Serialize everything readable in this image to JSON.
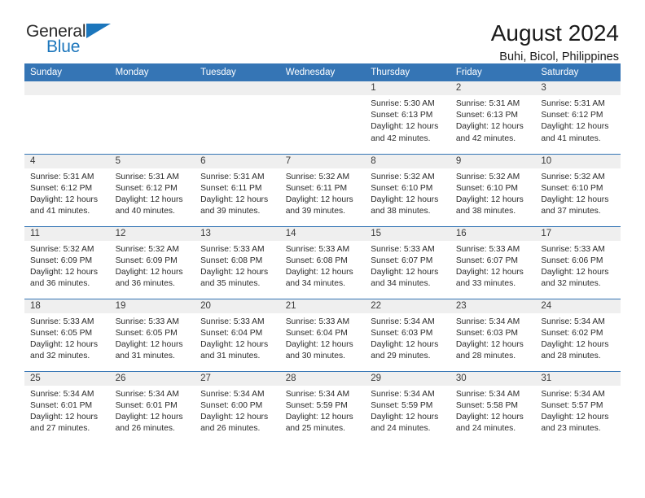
{
  "logo": {
    "word_one": "General",
    "word_two": "Blue",
    "triangle_color": "#1c76bc"
  },
  "header": {
    "title": "August 2024",
    "subtitle": "Buhi, Bicol, Philippines"
  },
  "theme": {
    "header_blue": "#3575b5",
    "daynum_band": "#efefef",
    "text": "#2b2b2b"
  },
  "weekday_headers": [
    "Sunday",
    "Monday",
    "Tuesday",
    "Wednesday",
    "Thursday",
    "Friday",
    "Saturday"
  ],
  "weeks": [
    [
      {
        "day": "",
        "blank": true
      },
      {
        "day": "",
        "blank": true
      },
      {
        "day": "",
        "blank": true
      },
      {
        "day": "",
        "blank": true
      },
      {
        "day": "1",
        "sunrise": "Sunrise: 5:30 AM",
        "sunset": "Sunset: 6:13 PM",
        "daylight_1": "Daylight: 12 hours",
        "daylight_2": "and 42 minutes."
      },
      {
        "day": "2",
        "sunrise": "Sunrise: 5:31 AM",
        "sunset": "Sunset: 6:13 PM",
        "daylight_1": "Daylight: 12 hours",
        "daylight_2": "and 42 minutes."
      },
      {
        "day": "3",
        "sunrise": "Sunrise: 5:31 AM",
        "sunset": "Sunset: 6:12 PM",
        "daylight_1": "Daylight: 12 hours",
        "daylight_2": "and 41 minutes."
      }
    ],
    [
      {
        "day": "4",
        "sunrise": "Sunrise: 5:31 AM",
        "sunset": "Sunset: 6:12 PM",
        "daylight_1": "Daylight: 12 hours",
        "daylight_2": "and 41 minutes."
      },
      {
        "day": "5",
        "sunrise": "Sunrise: 5:31 AM",
        "sunset": "Sunset: 6:12 PM",
        "daylight_1": "Daylight: 12 hours",
        "daylight_2": "and 40 minutes."
      },
      {
        "day": "6",
        "sunrise": "Sunrise: 5:31 AM",
        "sunset": "Sunset: 6:11 PM",
        "daylight_1": "Daylight: 12 hours",
        "daylight_2": "and 39 minutes."
      },
      {
        "day": "7",
        "sunrise": "Sunrise: 5:32 AM",
        "sunset": "Sunset: 6:11 PM",
        "daylight_1": "Daylight: 12 hours",
        "daylight_2": "and 39 minutes."
      },
      {
        "day": "8",
        "sunrise": "Sunrise: 5:32 AM",
        "sunset": "Sunset: 6:10 PM",
        "daylight_1": "Daylight: 12 hours",
        "daylight_2": "and 38 minutes."
      },
      {
        "day": "9",
        "sunrise": "Sunrise: 5:32 AM",
        "sunset": "Sunset: 6:10 PM",
        "daylight_1": "Daylight: 12 hours",
        "daylight_2": "and 38 minutes."
      },
      {
        "day": "10",
        "sunrise": "Sunrise: 5:32 AM",
        "sunset": "Sunset: 6:10 PM",
        "daylight_1": "Daylight: 12 hours",
        "daylight_2": "and 37 minutes."
      }
    ],
    [
      {
        "day": "11",
        "sunrise": "Sunrise: 5:32 AM",
        "sunset": "Sunset: 6:09 PM",
        "daylight_1": "Daylight: 12 hours",
        "daylight_2": "and 36 minutes."
      },
      {
        "day": "12",
        "sunrise": "Sunrise: 5:32 AM",
        "sunset": "Sunset: 6:09 PM",
        "daylight_1": "Daylight: 12 hours",
        "daylight_2": "and 36 minutes."
      },
      {
        "day": "13",
        "sunrise": "Sunrise: 5:33 AM",
        "sunset": "Sunset: 6:08 PM",
        "daylight_1": "Daylight: 12 hours",
        "daylight_2": "and 35 minutes."
      },
      {
        "day": "14",
        "sunrise": "Sunrise: 5:33 AM",
        "sunset": "Sunset: 6:08 PM",
        "daylight_1": "Daylight: 12 hours",
        "daylight_2": "and 34 minutes."
      },
      {
        "day": "15",
        "sunrise": "Sunrise: 5:33 AM",
        "sunset": "Sunset: 6:07 PM",
        "daylight_1": "Daylight: 12 hours",
        "daylight_2": "and 34 minutes."
      },
      {
        "day": "16",
        "sunrise": "Sunrise: 5:33 AM",
        "sunset": "Sunset: 6:07 PM",
        "daylight_1": "Daylight: 12 hours",
        "daylight_2": "and 33 minutes."
      },
      {
        "day": "17",
        "sunrise": "Sunrise: 5:33 AM",
        "sunset": "Sunset: 6:06 PM",
        "daylight_1": "Daylight: 12 hours",
        "daylight_2": "and 32 minutes."
      }
    ],
    [
      {
        "day": "18",
        "sunrise": "Sunrise: 5:33 AM",
        "sunset": "Sunset: 6:05 PM",
        "daylight_1": "Daylight: 12 hours",
        "daylight_2": "and 32 minutes."
      },
      {
        "day": "19",
        "sunrise": "Sunrise: 5:33 AM",
        "sunset": "Sunset: 6:05 PM",
        "daylight_1": "Daylight: 12 hours",
        "daylight_2": "and 31 minutes."
      },
      {
        "day": "20",
        "sunrise": "Sunrise: 5:33 AM",
        "sunset": "Sunset: 6:04 PM",
        "daylight_1": "Daylight: 12 hours",
        "daylight_2": "and 31 minutes."
      },
      {
        "day": "21",
        "sunrise": "Sunrise: 5:33 AM",
        "sunset": "Sunset: 6:04 PM",
        "daylight_1": "Daylight: 12 hours",
        "daylight_2": "and 30 minutes."
      },
      {
        "day": "22",
        "sunrise": "Sunrise: 5:34 AM",
        "sunset": "Sunset: 6:03 PM",
        "daylight_1": "Daylight: 12 hours",
        "daylight_2": "and 29 minutes."
      },
      {
        "day": "23",
        "sunrise": "Sunrise: 5:34 AM",
        "sunset": "Sunset: 6:03 PM",
        "daylight_1": "Daylight: 12 hours",
        "daylight_2": "and 28 minutes."
      },
      {
        "day": "24",
        "sunrise": "Sunrise: 5:34 AM",
        "sunset": "Sunset: 6:02 PM",
        "daylight_1": "Daylight: 12 hours",
        "daylight_2": "and 28 minutes."
      }
    ],
    [
      {
        "day": "25",
        "sunrise": "Sunrise: 5:34 AM",
        "sunset": "Sunset: 6:01 PM",
        "daylight_1": "Daylight: 12 hours",
        "daylight_2": "and 27 minutes."
      },
      {
        "day": "26",
        "sunrise": "Sunrise: 5:34 AM",
        "sunset": "Sunset: 6:01 PM",
        "daylight_1": "Daylight: 12 hours",
        "daylight_2": "and 26 minutes."
      },
      {
        "day": "27",
        "sunrise": "Sunrise: 5:34 AM",
        "sunset": "Sunset: 6:00 PM",
        "daylight_1": "Daylight: 12 hours",
        "daylight_2": "and 26 minutes."
      },
      {
        "day": "28",
        "sunrise": "Sunrise: 5:34 AM",
        "sunset": "Sunset: 5:59 PM",
        "daylight_1": "Daylight: 12 hours",
        "daylight_2": "and 25 minutes."
      },
      {
        "day": "29",
        "sunrise": "Sunrise: 5:34 AM",
        "sunset": "Sunset: 5:59 PM",
        "daylight_1": "Daylight: 12 hours",
        "daylight_2": "and 24 minutes."
      },
      {
        "day": "30",
        "sunrise": "Sunrise: 5:34 AM",
        "sunset": "Sunset: 5:58 PM",
        "daylight_1": "Daylight: 12 hours",
        "daylight_2": "and 24 minutes."
      },
      {
        "day": "31",
        "sunrise": "Sunrise: 5:34 AM",
        "sunset": "Sunset: 5:57 PM",
        "daylight_1": "Daylight: 12 hours",
        "daylight_2": "and 23 minutes."
      }
    ]
  ]
}
